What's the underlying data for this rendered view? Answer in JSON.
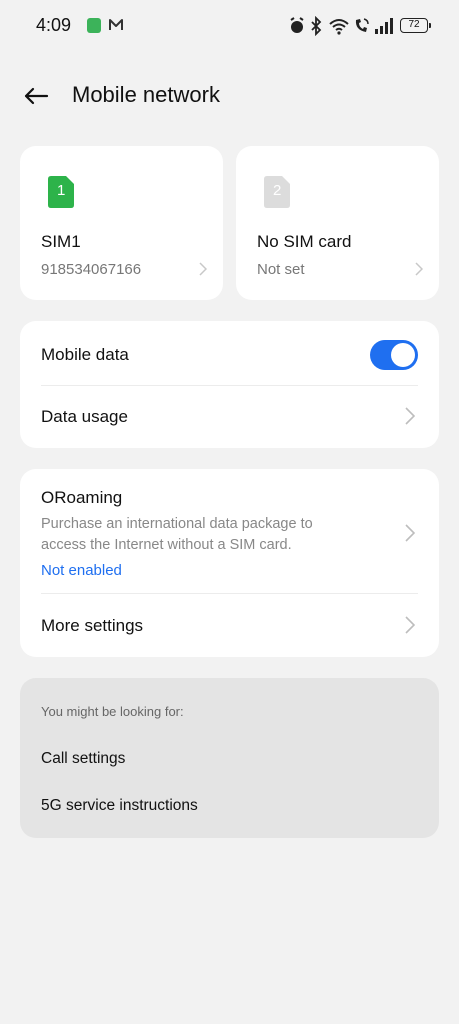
{
  "status_bar": {
    "time": "4:09",
    "battery": "72",
    "icons": [
      "app-notification-icon",
      "mail-icon",
      "alarm-icon",
      "bluetooth-icon",
      "wifi-icon",
      "wifi-calling-icon",
      "signal-icon",
      "battery-icon"
    ]
  },
  "header": {
    "title": "Mobile network"
  },
  "sims": [
    {
      "slot": "1",
      "name": "SIM1",
      "number": "918534067166",
      "color": "#2db34a"
    },
    {
      "slot": "2",
      "name": "No SIM card",
      "number": "Not set",
      "color": "#dcdcdc"
    }
  ],
  "data_section": {
    "mobile_data_label": "Mobile data",
    "mobile_data_enabled": true,
    "data_usage_label": "Data usage"
  },
  "roaming_section": {
    "title": "ORoaming",
    "description": "Purchase an international data package to access the Internet without a SIM card.",
    "status": "Not enabled",
    "more_settings_label": "More settings"
  },
  "suggestions": {
    "header": "You might be looking for:",
    "items": [
      "Call settings",
      "5G service instructions"
    ]
  },
  "colors": {
    "accent": "#1f6ff0",
    "background": "#f2f2f2"
  }
}
